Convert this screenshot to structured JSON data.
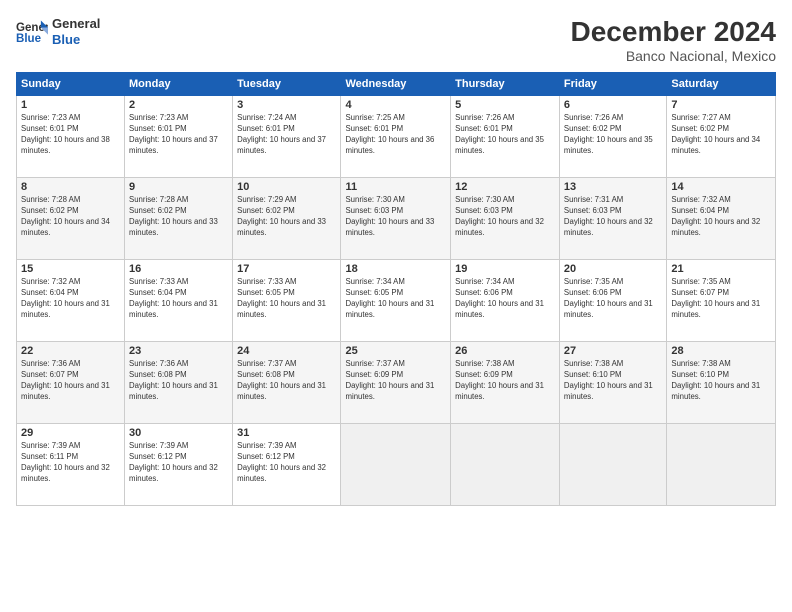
{
  "header": {
    "logo": {
      "line1": "General",
      "line2": "Blue"
    },
    "title": "December 2024",
    "location": "Banco Nacional, Mexico"
  },
  "weekdays": [
    "Sunday",
    "Monday",
    "Tuesday",
    "Wednesday",
    "Thursday",
    "Friday",
    "Saturday"
  ],
  "weeks": [
    [
      {
        "day": "1",
        "sunrise": "7:23 AM",
        "sunset": "6:01 PM",
        "daylight": "10 hours and 38 minutes."
      },
      {
        "day": "2",
        "sunrise": "7:23 AM",
        "sunset": "6:01 PM",
        "daylight": "10 hours and 37 minutes."
      },
      {
        "day": "3",
        "sunrise": "7:24 AM",
        "sunset": "6:01 PM",
        "daylight": "10 hours and 37 minutes."
      },
      {
        "day": "4",
        "sunrise": "7:25 AM",
        "sunset": "6:01 PM",
        "daylight": "10 hours and 36 minutes."
      },
      {
        "day": "5",
        "sunrise": "7:26 AM",
        "sunset": "6:01 PM",
        "daylight": "10 hours and 35 minutes."
      },
      {
        "day": "6",
        "sunrise": "7:26 AM",
        "sunset": "6:02 PM",
        "daylight": "10 hours and 35 minutes."
      },
      {
        "day": "7",
        "sunrise": "7:27 AM",
        "sunset": "6:02 PM",
        "daylight": "10 hours and 34 minutes."
      }
    ],
    [
      {
        "day": "8",
        "sunrise": "7:28 AM",
        "sunset": "6:02 PM",
        "daylight": "10 hours and 34 minutes."
      },
      {
        "day": "9",
        "sunrise": "7:28 AM",
        "sunset": "6:02 PM",
        "daylight": "10 hours and 33 minutes."
      },
      {
        "day": "10",
        "sunrise": "7:29 AM",
        "sunset": "6:02 PM",
        "daylight": "10 hours and 33 minutes."
      },
      {
        "day": "11",
        "sunrise": "7:30 AM",
        "sunset": "6:03 PM",
        "daylight": "10 hours and 33 minutes."
      },
      {
        "day": "12",
        "sunrise": "7:30 AM",
        "sunset": "6:03 PM",
        "daylight": "10 hours and 32 minutes."
      },
      {
        "day": "13",
        "sunrise": "7:31 AM",
        "sunset": "6:03 PM",
        "daylight": "10 hours and 32 minutes."
      },
      {
        "day": "14",
        "sunrise": "7:32 AM",
        "sunset": "6:04 PM",
        "daylight": "10 hours and 32 minutes."
      }
    ],
    [
      {
        "day": "15",
        "sunrise": "7:32 AM",
        "sunset": "6:04 PM",
        "daylight": "10 hours and 31 minutes."
      },
      {
        "day": "16",
        "sunrise": "7:33 AM",
        "sunset": "6:04 PM",
        "daylight": "10 hours and 31 minutes."
      },
      {
        "day": "17",
        "sunrise": "7:33 AM",
        "sunset": "6:05 PM",
        "daylight": "10 hours and 31 minutes."
      },
      {
        "day": "18",
        "sunrise": "7:34 AM",
        "sunset": "6:05 PM",
        "daylight": "10 hours and 31 minutes."
      },
      {
        "day": "19",
        "sunrise": "7:34 AM",
        "sunset": "6:06 PM",
        "daylight": "10 hours and 31 minutes."
      },
      {
        "day": "20",
        "sunrise": "7:35 AM",
        "sunset": "6:06 PM",
        "daylight": "10 hours and 31 minutes."
      },
      {
        "day": "21",
        "sunrise": "7:35 AM",
        "sunset": "6:07 PM",
        "daylight": "10 hours and 31 minutes."
      }
    ],
    [
      {
        "day": "22",
        "sunrise": "7:36 AM",
        "sunset": "6:07 PM",
        "daylight": "10 hours and 31 minutes."
      },
      {
        "day": "23",
        "sunrise": "7:36 AM",
        "sunset": "6:08 PM",
        "daylight": "10 hours and 31 minutes."
      },
      {
        "day": "24",
        "sunrise": "7:37 AM",
        "sunset": "6:08 PM",
        "daylight": "10 hours and 31 minutes."
      },
      {
        "day": "25",
        "sunrise": "7:37 AM",
        "sunset": "6:09 PM",
        "daylight": "10 hours and 31 minutes."
      },
      {
        "day": "26",
        "sunrise": "7:38 AM",
        "sunset": "6:09 PM",
        "daylight": "10 hours and 31 minutes."
      },
      {
        "day": "27",
        "sunrise": "7:38 AM",
        "sunset": "6:10 PM",
        "daylight": "10 hours and 31 minutes."
      },
      {
        "day": "28",
        "sunrise": "7:38 AM",
        "sunset": "6:10 PM",
        "daylight": "10 hours and 31 minutes."
      }
    ],
    [
      {
        "day": "29",
        "sunrise": "7:39 AM",
        "sunset": "6:11 PM",
        "daylight": "10 hours and 32 minutes."
      },
      {
        "day": "30",
        "sunrise": "7:39 AM",
        "sunset": "6:12 PM",
        "daylight": "10 hours and 32 minutes."
      },
      {
        "day": "31",
        "sunrise": "7:39 AM",
        "sunset": "6:12 PM",
        "daylight": "10 hours and 32 minutes."
      },
      null,
      null,
      null,
      null
    ]
  ]
}
